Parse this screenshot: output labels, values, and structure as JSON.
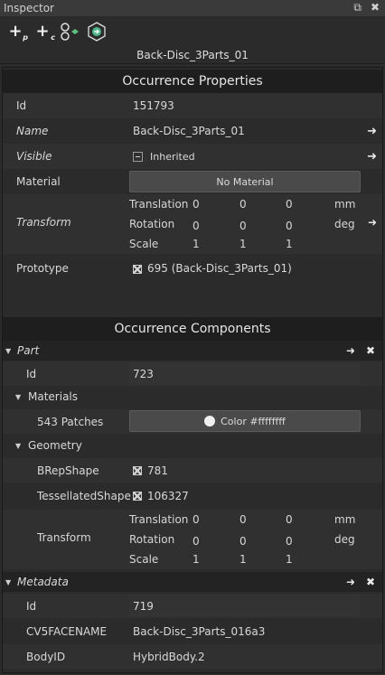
{
  "window": {
    "title": "Inspector",
    "pin_icon": "pin-icon",
    "close_icon": "close-icon"
  },
  "toolbar": {
    "add_part_icon": "add-part-icon",
    "add_part_sub": "p",
    "add_component_icon": "add-component-icon",
    "add_component_sub": "c",
    "hierarchy_icon": "hierarchy-icon",
    "go_icon": "go-to-icon"
  },
  "occurrence_name": "Back-Disc_3Parts_01",
  "occurrence_properties": {
    "title": "Occurrence Properties",
    "id_label": "Id",
    "id_value": "151793",
    "name_label": "Name",
    "name_value": "Back-Disc_3Parts_01",
    "visible_label": "Visible",
    "visible_value": "Inherited",
    "material_label": "Material",
    "material_value": "No Material",
    "transform_label": "Transform",
    "translation_label": "Translation",
    "translation": [
      "0",
      "0",
      "0"
    ],
    "translation_unit": "mm",
    "rotation_label": "Rotation",
    "rotation": [
      "0",
      "0",
      "0"
    ],
    "rotation_unit": "deg",
    "scale_label": "Scale",
    "scale": [
      "1",
      "1",
      "1"
    ],
    "prototype_label": "Prototype",
    "prototype_value": "695 (Back-Disc_3Parts_01)"
  },
  "occurrence_components": {
    "title": "Occurrence Components",
    "part": {
      "label": "Part",
      "id_label": "Id",
      "id_value": "723",
      "materials_label": "Materials",
      "patches_label": "543 Patches",
      "color_value": "Color #ffffffff",
      "geometry_label": "Geometry",
      "brep_label": "BRepShape",
      "brep_value": "781",
      "tess_label": "TessellatedShape",
      "tess_value": "106327",
      "transform_label": "Transform",
      "translation_label": "Translation",
      "translation": [
        "0",
        "0",
        "0"
      ],
      "translation_unit": "mm",
      "rotation_label": "Rotation",
      "rotation": [
        "0",
        "0",
        "0"
      ],
      "rotation_unit": "deg",
      "scale_label": "Scale",
      "scale": [
        "1",
        "1",
        "1"
      ]
    },
    "metadata": {
      "label": "Metadata",
      "id_label": "Id",
      "id_value": "719",
      "cv5_label": "CV5FACENAME",
      "cv5_value": "Back-Disc_3Parts_016a3",
      "body_label": "BodyID",
      "body_value": "HybridBody.2"
    }
  }
}
